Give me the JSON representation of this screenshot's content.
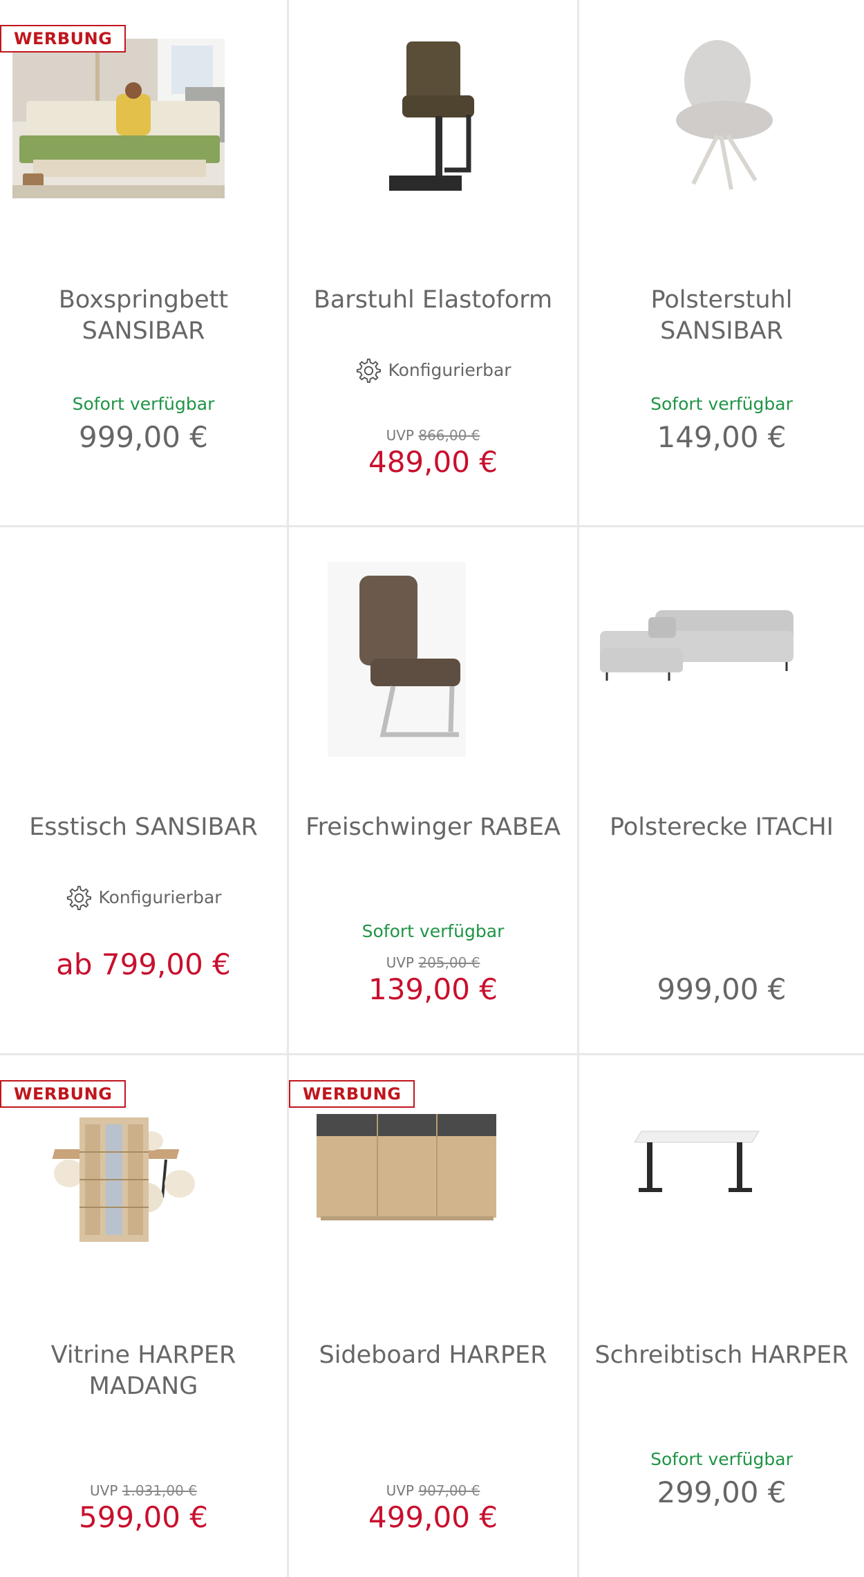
{
  "ad_label": "WERBUNG",
  "konfig_label": "Konfigurierbar",
  "available_label": "Sofort verfügbar",
  "uvp_label": "UVP",
  "colors": {
    "sale": "#c8102e",
    "available": "#1f9446",
    "ad": "#c0161d"
  },
  "products": [
    {
      "name": "Boxspringbett SANSIBAR",
      "price": "999,00 €"
    },
    {
      "name": "Barstuhl Elastoform",
      "uvp": "866,00 €",
      "price": "489,00 €"
    },
    {
      "name": "Polsterstuhl SANSIBAR",
      "price": "149,00 €"
    },
    {
      "name": "Esstisch SANSIBAR",
      "price": "ab 799,00 €"
    },
    {
      "name": "Freischwinger RABEA",
      "uvp": "205,00 €",
      "price": "139,00 €"
    },
    {
      "name": "Polsterecke ITACHI",
      "price": "999,00 €"
    },
    {
      "name": "Vitrine HARPER MADANG",
      "uvp": "1.031,00 €",
      "price": "599,00 €"
    },
    {
      "name": "Sideboard HARPER",
      "uvp": "907,00 €",
      "price": "499,00 €"
    },
    {
      "name": "Schreibtisch HARPER",
      "price": "299,00 €"
    }
  ]
}
